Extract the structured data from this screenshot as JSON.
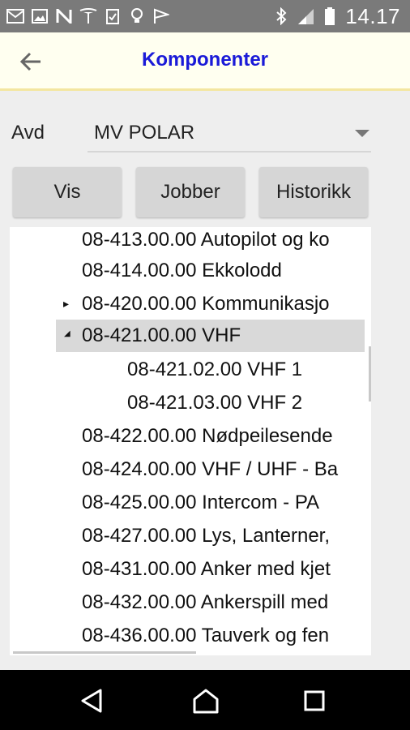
{
  "status_bar": {
    "time": "14.17",
    "left_icons": [
      "gmail-icon",
      "image-icon",
      "n-app-icon",
      "tesla-icon",
      "clipboard-check-icon",
      "lightbulb-icon",
      "flag-icon"
    ],
    "right_icons": [
      "bluetooth-icon",
      "signal-icon",
      "battery-icon"
    ]
  },
  "app_bar": {
    "title": "Komponenter",
    "back_icon": "arrow-left-icon",
    "title_color": "#1a1ad8"
  },
  "filter": {
    "label": "Avd",
    "selected": "MV POLAR"
  },
  "buttons": {
    "vis": "Vis",
    "jobber": "Jobber",
    "historikk": "Historikk"
  },
  "tree": {
    "items": [
      {
        "text": "08-413.00.00 Autopilot og ko",
        "level": 0,
        "expander": ""
      },
      {
        "text": "08-414.00.00 Ekkolodd",
        "level": 0,
        "expander": ""
      },
      {
        "text": "08-420.00.00 Kommunikasjo",
        "level": 0,
        "expander": "▸"
      },
      {
        "text": "08-421.00.00 VHF",
        "level": 0,
        "expander": "◢",
        "selected": true
      },
      {
        "text": "08-421.02.00 VHF 1",
        "level": 1,
        "expander": ""
      },
      {
        "text": "08-421.03.00 VHF 2",
        "level": 1,
        "expander": ""
      },
      {
        "text": "08-422.00.00 Nødpeilesende",
        "level": 0,
        "expander": ""
      },
      {
        "text": "08-424.00.00 VHF / UHF - Ba",
        "level": 0,
        "expander": ""
      },
      {
        "text": "08-425.00.00 Intercom - PA",
        "level": 0,
        "expander": ""
      },
      {
        "text": "08-427.00.00 Lys, Lanterner,",
        "level": 0,
        "expander": ""
      },
      {
        "text": "08-431.00.00 Anker med kjet",
        "level": 0,
        "expander": ""
      },
      {
        "text": "08-432.00.00 Ankerspill med",
        "level": 0,
        "expander": ""
      },
      {
        "text": "08-436.00.00 Tauverk og fen",
        "level": 0,
        "expander": ""
      }
    ]
  },
  "nav_bar": {
    "buttons": [
      "back-triangle-icon",
      "home-icon",
      "recents-icon"
    ]
  }
}
